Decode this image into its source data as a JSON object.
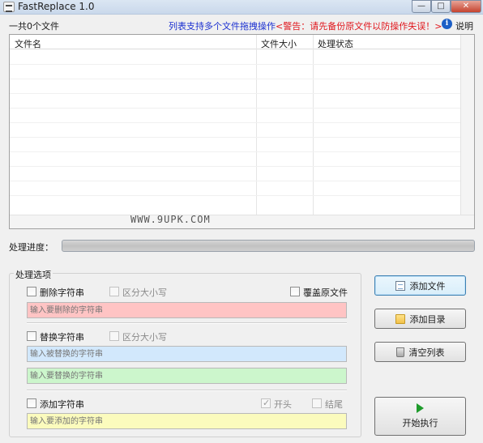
{
  "window": {
    "title": "FastReplace 1.0",
    "minimize_glyph": "—",
    "maximize_glyph": "□",
    "close_glyph": "✕"
  },
  "info": {
    "file_count": "一共0个文件",
    "drag_tip": "列表支持多个文件拖拽操作",
    "warning": "<警告：请先备份原文件以防操作失误！>",
    "help_glyph": "i",
    "help_label": "说明"
  },
  "file_list": {
    "columns": [
      "文件名",
      "文件大小",
      "处理状态"
    ],
    "rows": []
  },
  "watermark": "WWW.9UPK.COM",
  "progress": {
    "label": "处理进度：",
    "value": 0
  },
  "options": {
    "title": "处理选项",
    "delete": {
      "label": "删除字符串",
      "checked": false,
      "case_label": "区分大小写",
      "placeholder": "输入要删除的字符串"
    },
    "overwrite": {
      "label": "覆盖原文件",
      "checked": false
    },
    "replace": {
      "label": "替换字符串",
      "checked": false,
      "case_label": "区分大小写",
      "find_placeholder": "输入被替换的字符串",
      "with_placeholder": "输入要替换的字符串"
    },
    "add": {
      "label": "添加字符串",
      "checked": false,
      "head_label": "开头",
      "head_checked": true,
      "tail_label": "结尾",
      "tail_checked": false,
      "placeholder": "输入要添加的字符串"
    }
  },
  "buttons": {
    "add_file": "添加文件",
    "add_dir": "添加目录",
    "clear_list": "清空列表",
    "start": "开始执行"
  },
  "icons": {
    "app": "app-icon",
    "help": "info-icon",
    "add_file": "file-icon",
    "add_dir": "folder-icon",
    "clear_list": "trash-icon",
    "start": "play-icon"
  },
  "colors": {
    "drag_tip": "#1a2fd0",
    "warning": "#e0161c",
    "delete_field": "#ffc4c4",
    "find_field": "#d2e8fc",
    "replace_field": "#ccf6cc",
    "add_field": "#fbfbbd"
  }
}
